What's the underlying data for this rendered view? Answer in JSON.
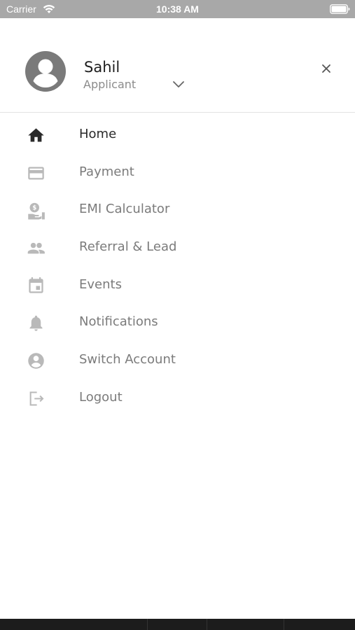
{
  "status_bar": {
    "carrier": "Carrier",
    "time": "10:38 AM"
  },
  "profile": {
    "name": "Sahil",
    "role": "Applicant"
  },
  "menu": {
    "items": [
      {
        "label": "Home",
        "icon": "home-icon",
        "active": true
      },
      {
        "label": "Payment",
        "icon": "credit-card-icon",
        "active": false
      },
      {
        "label": "EMI Calculator",
        "icon": "emi-calculator-icon",
        "active": false
      },
      {
        "label": "Referral & Lead",
        "icon": "people-icon",
        "active": false
      },
      {
        "label": "Events",
        "icon": "calendar-icon",
        "active": false
      },
      {
        "label": "Notifications",
        "icon": "bell-icon",
        "active": false
      },
      {
        "label": "Switch Account",
        "icon": "account-circle-icon",
        "active": false
      },
      {
        "label": "Logout",
        "icon": "logout-icon",
        "active": false
      }
    ]
  },
  "colors": {
    "status_bar_bg": "#a8a8a8",
    "active_icon": "#2a2a2a",
    "inactive_icon": "#b9b9b9",
    "active_label": "#2a2a2a",
    "inactive_label": "#7b7b7b"
  }
}
